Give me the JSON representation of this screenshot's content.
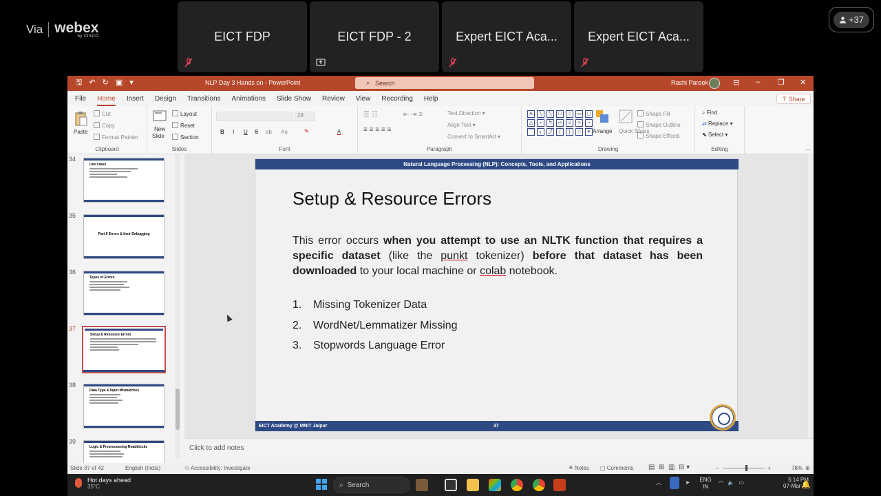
{
  "webex": {
    "via": "Via",
    "brand": "webex",
    "by": "by CISCO"
  },
  "tiles": [
    {
      "label": "EICT FDP"
    },
    {
      "label": "EICT FDP - 2"
    },
    {
      "label": "Expert EICT Aca..."
    },
    {
      "label": "Expert EICT Aca..."
    }
  ],
  "participants": {
    "count": "+37"
  },
  "window": {
    "doc_title": "NLP Day 3 Hands on  -  PowerPoint",
    "search_placeholder": "Search",
    "user": "Rashi Pareek"
  },
  "menu": {
    "tabs": [
      "File",
      "Home",
      "Insert",
      "Design",
      "Transitions",
      "Animations",
      "Slide Show",
      "Review",
      "View",
      "Recording",
      "Help"
    ],
    "active": "Home",
    "share": "Share"
  },
  "ribbon": {
    "clipboard": {
      "paste": "Paste",
      "cut": "Cut",
      "copy": "Copy",
      "format_painter": "Format Painter",
      "label": "Clipboard"
    },
    "slides": {
      "new_slide": "New",
      "new_slide2": "Slide",
      "layout": "Layout",
      "reset": "Reset",
      "section": "Section",
      "label": "Slides"
    },
    "font": {
      "size": "28",
      "label": "Font",
      "bold": "B",
      "italic": "I",
      "underline": "U",
      "strike": "S",
      "ab": "ab",
      "aa": "Aa",
      "color_a": "A"
    },
    "paragraph": {
      "text_direction": "Text Direction",
      "align_text": "Align Text",
      "smartart": "Convert to SmartArt",
      "label": "Paragraph"
    },
    "drawing": {
      "arrange": "Arrange",
      "quick_styles": "Quick Styles",
      "shape_fill": "Shape Fill",
      "shape_outline": "Shape Outline",
      "shape_effects": "Shape Effects",
      "label": "Drawing"
    },
    "editing": {
      "find": "Find",
      "replace": "Replace",
      "select": "Select",
      "label": "Editing"
    }
  },
  "thumbnails": [
    {
      "num": "34",
      "title": "Use cases"
    },
    {
      "num": "35",
      "title": "Part II Errors & their Debugging"
    },
    {
      "num": "36",
      "title": "Types of Errors"
    },
    {
      "num": "37",
      "title": "Setup & Resource Errors"
    },
    {
      "num": "38",
      "title": "Data Type & Input Mismatches"
    },
    {
      "num": "39",
      "title": "Logic & Preprocessing Roadblocks"
    }
  ],
  "slide": {
    "header": "Natural Language Processing (NLP): Concepts, Tools, and Applications",
    "title": "Setup & Resource Errors",
    "body": {
      "p1": "This error occurs ",
      "b1": "when you attempt to use an NLTK function that requires a specific dataset",
      "p2": " (like the ",
      "u1": "punkt",
      "p3": " tokenizer) ",
      "b2": "before that dataset has been downloaded",
      "p4": " to your local machine or ",
      "u2": "colab",
      "p5": " notebook."
    },
    "list": [
      {
        "n": "1.",
        "text": "Missing Tokenizer Data"
      },
      {
        "n": "2.",
        "text": "WordNet/Lemmatizer Missing"
      },
      {
        "n": "3.",
        "text": "Stopwords Language Error"
      }
    ],
    "footer_left": "EICT Academy @ MNIT Jaipur",
    "footer_num": "37"
  },
  "notes_placeholder": "Click to add notes",
  "status": {
    "slide_of": "Slide 37 of 42",
    "language": "English (India)",
    "accessibility": "Accessibility: Investigate",
    "notes": "Notes",
    "comments": "Comments",
    "zoom": "78%"
  },
  "taskbar": {
    "weather_title": "Hot days ahead",
    "weather_temp": "35°C",
    "search": "Search",
    "lang1": "ENG",
    "lang2": "IN",
    "time": "5:14 PM",
    "date": "07-Mar-26"
  },
  "colors": {
    "ppt_accent": "#b7472a",
    "slide_bar": "#2e4a85"
  }
}
